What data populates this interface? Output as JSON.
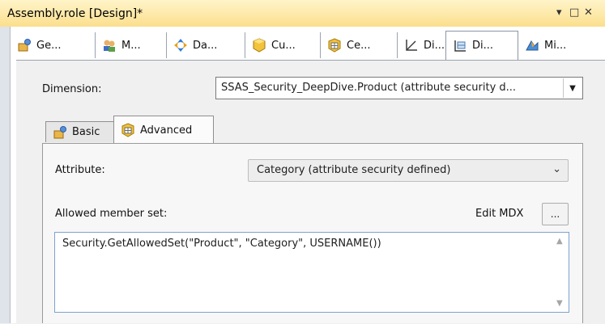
{
  "window": {
    "title": "Assembly.role [Design]*",
    "controls": [
      "▾",
      "□",
      "✕"
    ]
  },
  "tabs": [
    {
      "label": "Ge...",
      "icon": "general-icon"
    },
    {
      "label": "M...",
      "icon": "membership-icon"
    },
    {
      "label": "Da...",
      "icon": "data-sources-icon"
    },
    {
      "label": "Cu...",
      "icon": "cubes-icon"
    },
    {
      "label": "Ce...",
      "icon": "cell-data-icon"
    },
    {
      "label": "Di...",
      "icon": "dimensions-icon"
    },
    {
      "label": "Di...",
      "icon": "dimension-data-icon",
      "active": true
    },
    {
      "label": "Mi...",
      "icon": "mining-structures-icon"
    }
  ],
  "dimension": {
    "label": "Dimension:",
    "value": "SSAS_Security_DeepDive.Product (attribute security d..."
  },
  "subtabs": [
    {
      "label": "Basic",
      "icon": "basic-icon"
    },
    {
      "label": "Advanced",
      "icon": "advanced-icon",
      "active": true
    }
  ],
  "attribute": {
    "label": "Attribute:",
    "value": "Category (attribute security defined)"
  },
  "allowed": {
    "label": "Allowed member set:",
    "edit_mdx": "Edit MDX",
    "dots": "...",
    "expression": "Security.GetAllowedSet(\"Product\", \"Category\", USERNAME())"
  },
  "colors": {
    "titlebar": "#fbdf8d",
    "mdx_border": "#7da2ce"
  }
}
